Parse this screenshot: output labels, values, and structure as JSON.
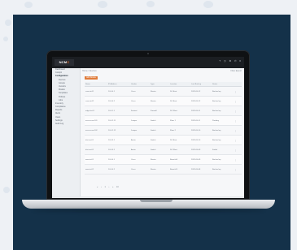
{
  "app": {
    "logo_main": "NCM",
    "logo_accent": "C",
    "title": "Admin",
    "top_icons": [
      "?",
      "◷",
      "⚙",
      "⏻",
      "≡"
    ]
  },
  "sidebar": {
    "items": [
      {
        "label": "Dashboard",
        "active": false,
        "sub": false
      },
      {
        "label": "Cockpit",
        "active": false,
        "sub": false
      },
      {
        "label": "Configuration",
        "active": true,
        "sub": false
      },
      {
        "label": "Devices",
        "active": false,
        "sub": true
      },
      {
        "label": "Groups",
        "active": false,
        "sub": true
      },
      {
        "label": "Vendors",
        "active": false,
        "sub": true
      },
      {
        "label": "Models",
        "active": false,
        "sub": true
      },
      {
        "label": "Templates",
        "active": false,
        "sub": true
      },
      {
        "label": "Policies",
        "active": false,
        "sub": true
      },
      {
        "label": "Jobs",
        "active": false,
        "sub": true
      },
      {
        "label": "Inventory",
        "active": false,
        "sub": false
      },
      {
        "label": "Compliance",
        "active": false,
        "sub": false
      },
      {
        "label": "Reports",
        "active": false,
        "sub": false
      },
      {
        "label": "Alerts",
        "active": false,
        "sub": false
      },
      {
        "label": "Users",
        "active": false,
        "sub": false
      },
      {
        "label": "Settings",
        "active": false,
        "sub": false
      },
      {
        "label": "Audit Log",
        "active": false,
        "sub": false
      }
    ]
  },
  "main": {
    "breadcrumb": "Home / Devices",
    "toolbar_right": "Filter   Export",
    "tag_button": "Add Device"
  },
  "table": {
    "headers": [
      "Name",
      "IP Address",
      "Vendor",
      "Type",
      "Location",
      "Last Backup",
      "Status",
      ""
    ],
    "rows": [
      [
        "core-rtr-01",
        "10.0.0.1",
        "Cisco",
        "Router",
        "DC-East",
        "2023-05-12",
        "Backed up",
        "⋮"
      ],
      [
        "core-rtr-02",
        "10.0.0.2",
        "Cisco",
        "Router",
        "DC-East",
        "2023-05-12",
        "Backed up",
        "⋮"
      ],
      [
        "edge-fw-01",
        "10.0.1.1",
        "Fortinet",
        "Firewall",
        "DC-West",
        "2023-05-11",
        "Backed up",
        "⋮"
      ],
      [
        "access-sw-101",
        "10.0.2.11",
        "Juniper",
        "Switch",
        "Floor 1",
        "2023-05-11",
        "Pending",
        "⋮"
      ],
      [
        "access-sw-102",
        "10.0.2.12",
        "Juniper",
        "Switch",
        "Floor 2",
        "2023-05-10",
        "Backed up",
        "⋮"
      ],
      [
        "dist-sw-01",
        "10.0.3.1",
        "Arista",
        "Switch",
        "DC-East",
        "2023-05-10",
        "Backed up",
        "⋮"
      ],
      [
        "dist-sw-02",
        "10.0.3.2",
        "Arista",
        "Switch",
        "DC-West",
        "2023-05-09",
        "Failed",
        "⋮"
      ],
      [
        "wan-rtr-01",
        "10.0.4.1",
        "Cisco",
        "Router",
        "Branch A",
        "2023-05-09",
        "Backed up",
        "⋮"
      ],
      [
        "wan-rtr-02",
        "10.0.4.2",
        "Cisco",
        "Router",
        "Branch B",
        "2023-05-08",
        "Backed up",
        "⋮"
      ]
    ]
  },
  "pager": {
    "first": "«",
    "prev": "‹",
    "page": "1",
    "next": "›",
    "last": "»",
    "per_page": "10"
  }
}
